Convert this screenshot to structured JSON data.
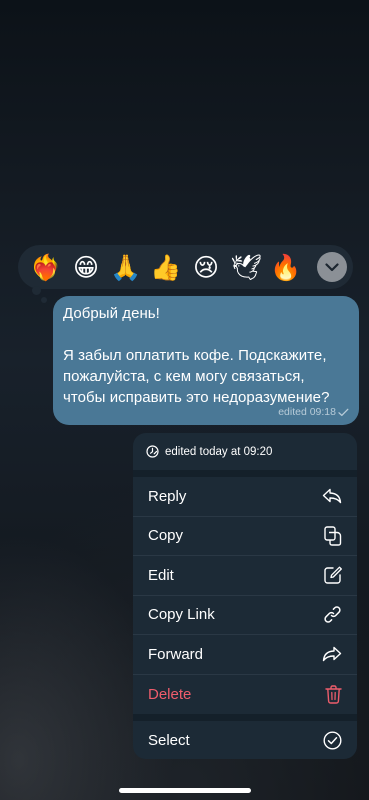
{
  "reactions": [
    {
      "emoji": "❤️‍🔥",
      "name": "heart-on-fire"
    },
    {
      "emoji": "😁",
      "name": "grin"
    },
    {
      "emoji": "🙏",
      "name": "folded-hands"
    },
    {
      "emoji": "👍",
      "name": "thumbs-up"
    },
    {
      "emoji": "😢",
      "name": "crying"
    },
    {
      "emoji": "🕊",
      "name": "dove"
    },
    {
      "emoji": "🔥",
      "name": "fire"
    }
  ],
  "message": {
    "text": "Добрый день!\n\nЯ забыл оплатить кофе. Подскажите, пожалуйста, с кем могу связаться, чтобы исправить это недоразумение?",
    "meta": "edited 09:18",
    "bubble_color": "#4a7896"
  },
  "menu": {
    "header": "edited today at 09:20",
    "items": [
      {
        "label": "Reply",
        "icon": "reply-icon"
      },
      {
        "label": "Copy",
        "icon": "copy-icon"
      },
      {
        "label": "Edit",
        "icon": "edit-icon"
      },
      {
        "label": "Copy Link",
        "icon": "link-icon"
      },
      {
        "label": "Forward",
        "icon": "forward-icon"
      },
      {
        "label": "Delete",
        "icon": "trash-icon",
        "color": "#ee5d6c"
      }
    ],
    "select": {
      "label": "Select",
      "icon": "check-circle-icon"
    }
  }
}
